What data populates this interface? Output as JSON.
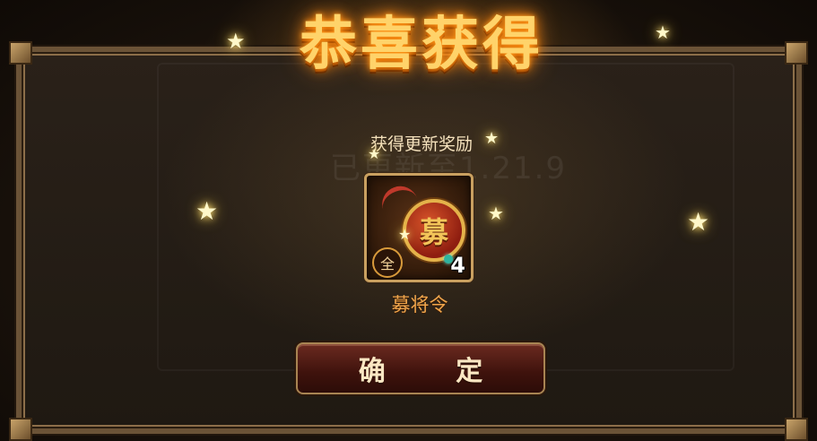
{
  "dialog": {
    "title": "恭喜获得",
    "subtitle": "获得更新奖励",
    "background_version_text": "已更新至1.21.9",
    "confirm_label": "确 定"
  },
  "reward": {
    "icon_glyph": "募",
    "name": "募将令",
    "quality_badge": "全",
    "count": "4"
  },
  "colors": {
    "title_gold": "#ffd36a",
    "item_name_orange": "#f0a64d",
    "frame_bronze": "#6b5337",
    "button_red": "#6b2a20"
  }
}
